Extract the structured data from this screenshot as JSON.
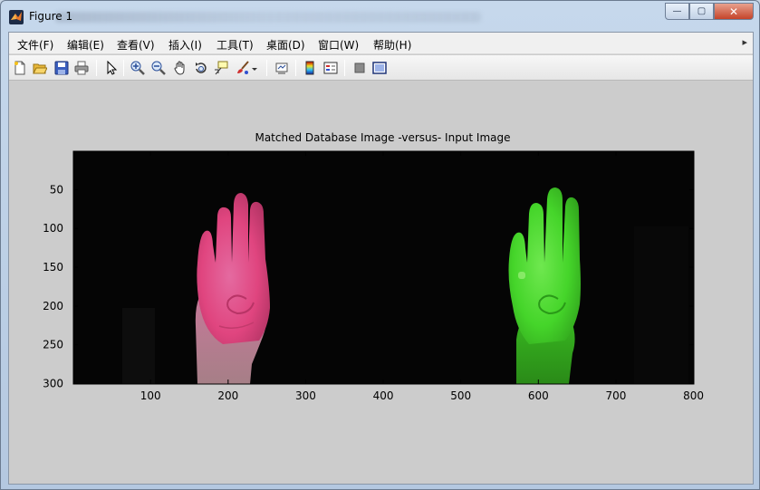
{
  "window": {
    "title": "Figure 1"
  },
  "titlebar_buttons": {
    "minimize": "—",
    "maximize": "▢",
    "close": "✕"
  },
  "menu": [
    {
      "label": "文件(F)"
    },
    {
      "label": "编辑(E)"
    },
    {
      "label": "查看(V)"
    },
    {
      "label": "插入(I)"
    },
    {
      "label": "工具(T)"
    },
    {
      "label": "桌面(D)"
    },
    {
      "label": "窗口(W)"
    },
    {
      "label": "帮助(H)"
    }
  ],
  "toolbar_icons": [
    "new-figure-icon",
    "open-file-icon",
    "save-icon",
    "print-icon",
    "edit-plot-arrow-icon",
    "zoom-in-icon",
    "zoom-out-icon",
    "pan-hand-icon",
    "rotate-3d-icon",
    "data-cursor-icon",
    "brush-icon",
    "brush-dropdown-icon",
    "link-plot-icon",
    "colorbar-icon",
    "legend-icon",
    "hide-plot-tools-icon",
    "show-plot-tools-icon"
  ],
  "colors": {
    "left_hand": "#e0457f",
    "right_hand": "#45d52a",
    "image_bg": "#050505",
    "figure_bg": "#cccccc"
  },
  "plot": {
    "title": "Matched Database Image -versus- Input Image",
    "xticks": [
      "100",
      "200",
      "300",
      "400",
      "500",
      "600",
      "700",
      "800"
    ],
    "yticks": [
      "50",
      "100",
      "150",
      "200",
      "250",
      "300"
    ]
  },
  "chart_data": {
    "type": "image",
    "title": "Matched Database Image -versus- Input Image",
    "xlabel": "",
    "ylabel": "",
    "xlim": [
      0.5,
      800.5
    ],
    "ylim": [
      300.5,
      0.5
    ],
    "y_reversed": true,
    "xticks": [
      100,
      200,
      300,
      400,
      500,
      600,
      700,
      800
    ],
    "yticks": [
      50,
      100,
      150,
      200,
      250,
      300
    ],
    "grid": false,
    "legend": "none"
  }
}
